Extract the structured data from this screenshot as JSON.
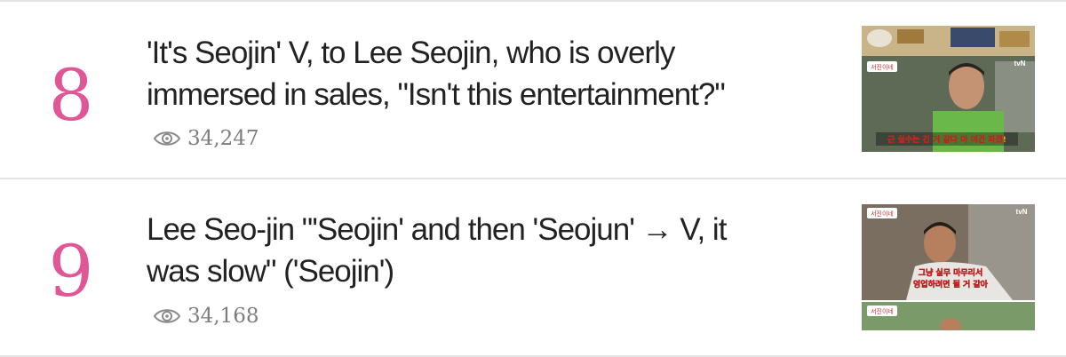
{
  "articles": [
    {
      "rank": "8",
      "title_line1": "'It's Seojin' V, to Lee Seojin, who is overly",
      "title_line2": "immersed in sales, \"Isn't this entertainment?\"",
      "views": "34,247",
      "thumbnail": {
        "channel_logo": "tvN",
        "show_badge": "서진이네",
        "caption": "근 실수는 긴 거 같다 아 이건 파겠!"
      }
    },
    {
      "rank": "9",
      "title_line1": "Lee Seo-jin \"'Seojin' and then 'Seojun' → V, it",
      "title_line2": "was slow\" ('Seojin')",
      "views": "34,168",
      "thumbnail": {
        "channel_logo": "tvN",
        "show_badge": "서진이네",
        "caption_line1": "그냥 실무 마무리서",
        "caption_line2": "영업하려면 될 거 같아",
        "show_badge_2": "서진이네"
      }
    }
  ],
  "icons": {
    "views": "eye-icon"
  },
  "colors": {
    "rank": "#e05797",
    "title": "#222222",
    "views": "#7d7d7d",
    "divider": "#e4e4e4"
  }
}
